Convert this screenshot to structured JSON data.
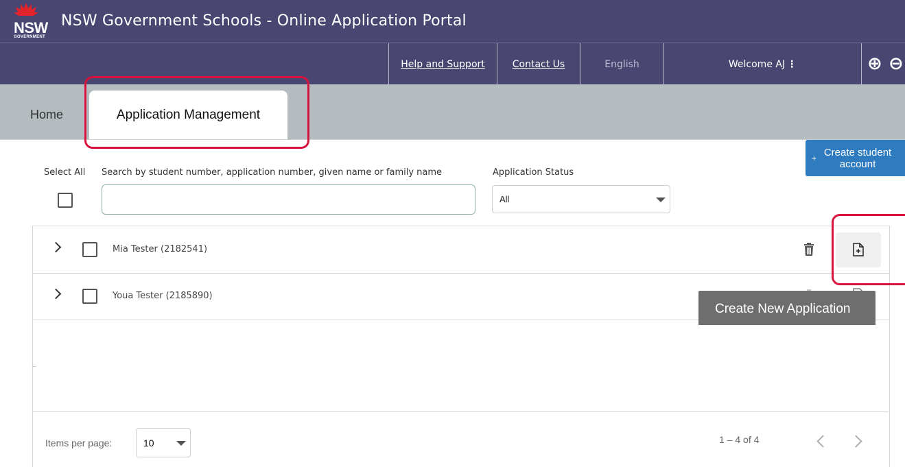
{
  "header": {
    "logo_text": "NSW",
    "logo_sub": "GOVERNMENT",
    "title": "NSW Government Schools - Online Application Portal"
  },
  "nav": {
    "help": "Help and Support",
    "contact": "Contact Us",
    "language": "English",
    "welcome": "Welcome AJ",
    "welcome_menu_glyph": "⋮",
    "zoom_in_glyph": "⊕",
    "zoom_out_glyph": "⊖"
  },
  "tabs": [
    {
      "label": "Home"
    },
    {
      "label": "Application Management"
    }
  ],
  "create_student": {
    "plus": "+",
    "label": "Create student account"
  },
  "filters": {
    "select_all_label": "Select All",
    "search_label": "Search by student number, application number, given name or family name",
    "search_value": "",
    "status_label": "Application Status",
    "status_value": "All"
  },
  "students": [
    {
      "name": "Mia Tester (2182541)"
    },
    {
      "name": "Youa Tester (2185890)"
    }
  ],
  "tooltip": "Create New Application",
  "pager": {
    "items_label": "Items per page:",
    "items_value": "10",
    "range": "1 – 4 of 4"
  },
  "colors": {
    "header": "#4a4672",
    "tabbar": "#b4bcc0",
    "highlight": "#d8123c",
    "create_button": "#2e7bbf"
  },
  "icons": [
    "nsw-waratah-logo",
    "kebab-menu-icon",
    "zoom-in-icon",
    "zoom-out-icon",
    "plus-icon",
    "chevron-right-icon",
    "trash-icon",
    "new-document-icon",
    "chevron-left-icon"
  ]
}
